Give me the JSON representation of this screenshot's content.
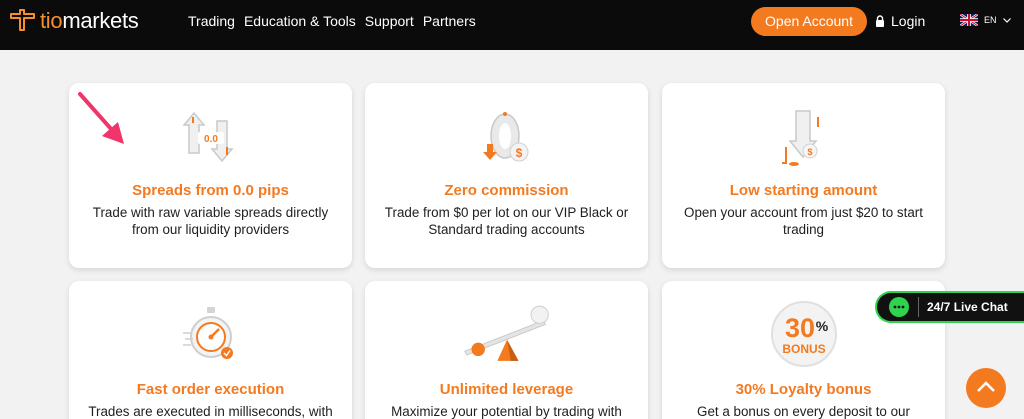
{
  "header": {
    "logo_prefix": "tio",
    "logo_suffix": "markets",
    "nav": [
      "Trading",
      "Education & Tools",
      "Support",
      "Partners"
    ],
    "open_account": "Open Account",
    "login": "Login",
    "language": "EN"
  },
  "cards": [
    {
      "title": "Spreads from 0.0 pips",
      "desc": "Trade with raw variable spreads directly from our liquidity providers",
      "icon_text": "0.0"
    },
    {
      "title": "Zero commission",
      "desc": "Trade from $0 per lot on our VIP Black or Standard trading accounts"
    },
    {
      "title": "Low starting amount",
      "desc": "Open your account from just $20 to start trading"
    },
    {
      "title": "Fast order execution",
      "desc": "Trades are executed in milliseconds, with"
    },
    {
      "title": "Unlimited leverage",
      "desc": "Maximize your potential by trading with"
    },
    {
      "title": "30% Loyalty bonus",
      "desc": "Get a bonus on every deposit to our",
      "icon_num": "30",
      "icon_pct": "%",
      "icon_bonus": "BONUS"
    }
  ],
  "chat": {
    "label": "24/7 Live Chat"
  },
  "colors": {
    "accent": "#f47a20",
    "header_bg": "#0b0b0b",
    "chat_border": "#2fd44c"
  }
}
